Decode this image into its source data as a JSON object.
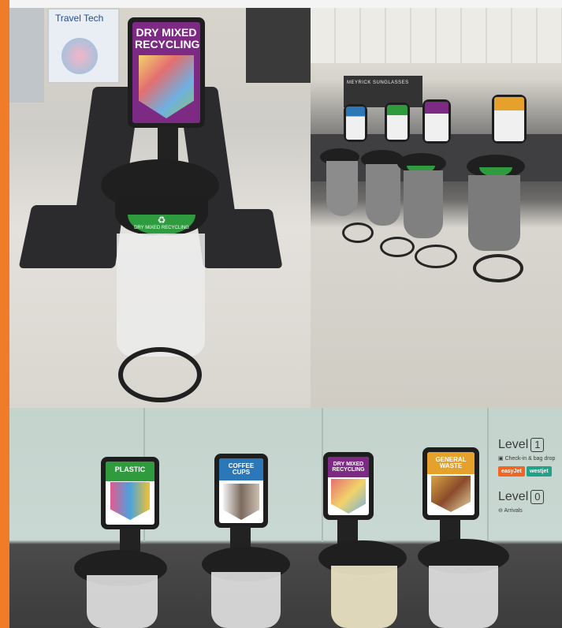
{
  "photo1": {
    "travel_sign": "Travel Tech",
    "recycling_sign": "DRY MIXED RECYCLING",
    "bin_label": "DRY MIXED RECYCLING"
  },
  "photo2": {
    "shop_name": "MEYRICK SUNGLASSES"
  },
  "photo3": {
    "signs": [
      {
        "label": "PLASTIC",
        "color": "#2f9a3e"
      },
      {
        "label": "COFFEE CUPS",
        "color": "#2b77b8"
      },
      {
        "label": "DRY MIXED RECYCLING",
        "color": "#7d2a84"
      },
      {
        "label": "GENERAL WASTE",
        "color": "#e5a12b"
      }
    ],
    "directory": {
      "level_word": "Level",
      "level1_num": "1",
      "level1_desc": "Check-in & bag drop",
      "airline1": "easyJet",
      "airline2": "westjet",
      "level0_num": "0",
      "level0_desc": "Arrivals"
    }
  }
}
